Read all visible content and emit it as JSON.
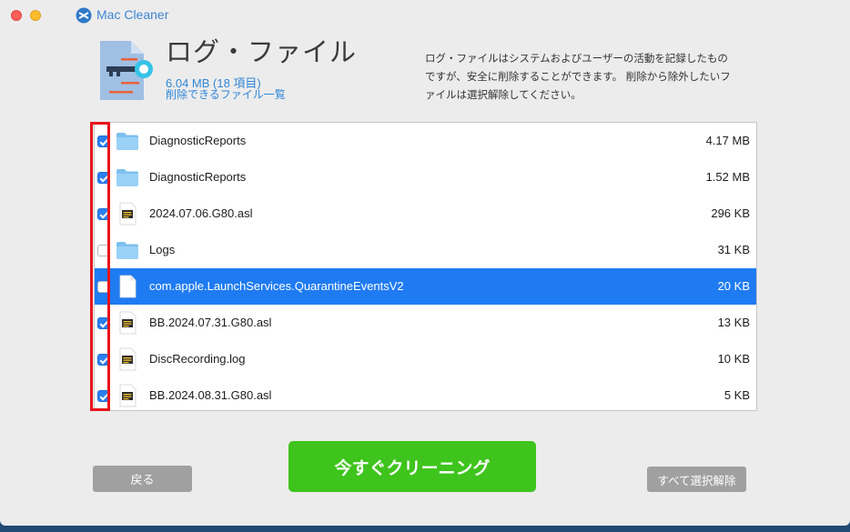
{
  "app": {
    "name": "Mac Cleaner"
  },
  "header": {
    "title": "ログ・ファイル",
    "size_summary": "6.04 MB (18 項目)",
    "list_link": "削除できるファイル一覧",
    "description": "ログ・ファイルはシステムおよびユーザーの活動を記録したものですが、安全に削除することができます。 削除から除外したいファイルは選択解除してください。"
  },
  "files": [
    {
      "name": "DiagnosticReports",
      "size": "4.17 MB",
      "checked": true,
      "icon": "folder-icon",
      "selected": false
    },
    {
      "name": "DiagnosticReports",
      "size": "1.52 MB",
      "checked": true,
      "icon": "folder-icon",
      "selected": false
    },
    {
      "name": "2024.07.06.G80.asl",
      "size": "296 KB",
      "checked": true,
      "icon": "log-file-icon",
      "selected": false
    },
    {
      "name": "Logs",
      "size": "31 KB",
      "checked": false,
      "icon": "folder-icon",
      "selected": false
    },
    {
      "name": "com.apple.LaunchServices.QuarantineEventsV2",
      "size": "20 KB",
      "checked": false,
      "icon": "blank-file-icon",
      "selected": true
    },
    {
      "name": "BB.2024.07.31.G80.asl",
      "size": "13 KB",
      "checked": true,
      "icon": "log-file-icon",
      "selected": false
    },
    {
      "name": "DiscRecording.log",
      "size": "10 KB",
      "checked": true,
      "icon": "log-file-icon",
      "selected": false
    },
    {
      "name": "BB.2024.08.31.G80.asl",
      "size": "5 KB",
      "checked": true,
      "icon": "log-file-icon",
      "selected": false
    }
  ],
  "footer": {
    "back_label": "戻る",
    "clean_label": "今すぐクリーニング",
    "deselect_all_label": "すべて選択解除"
  },
  "colors": {
    "accent_blue": "#2f86d8",
    "selection_blue": "#1f7bf2",
    "clean_green": "#3ec41c",
    "highlight_red": "#e8141b"
  }
}
